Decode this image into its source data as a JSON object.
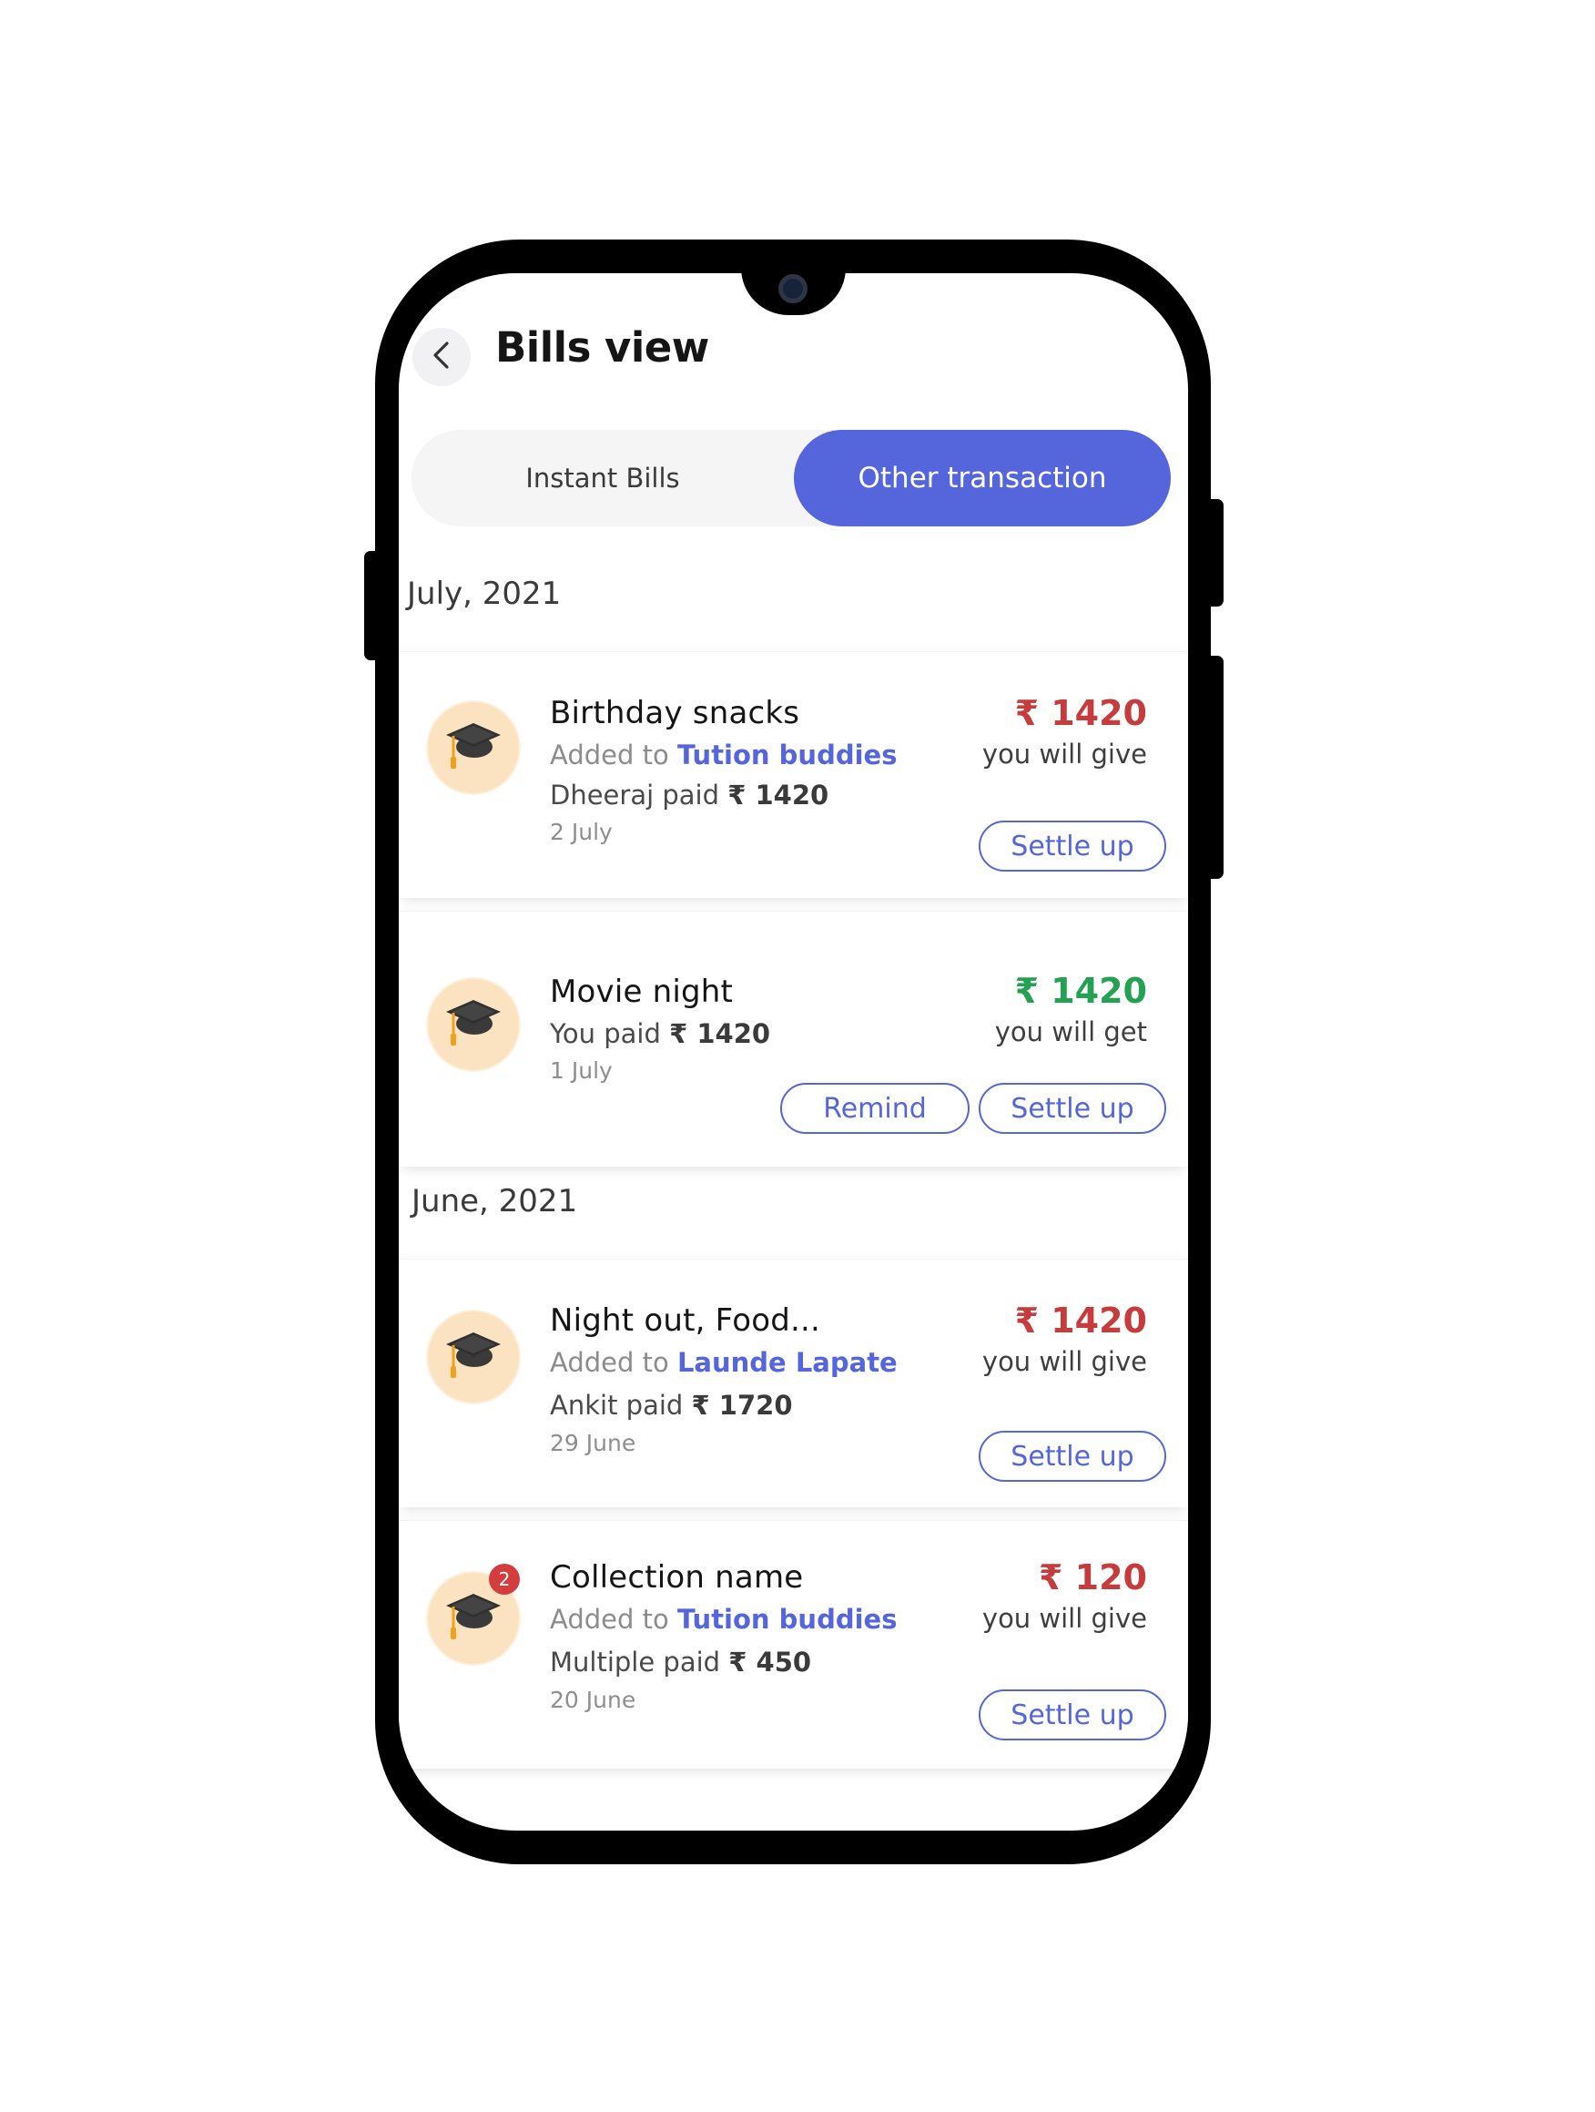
{
  "header": {
    "title": "Bills view",
    "back_icon": "chevron-left-icon"
  },
  "tabs": [
    {
      "label": "Instant Bills",
      "active": false
    },
    {
      "label": "Other transaction",
      "active": true
    }
  ],
  "colors": {
    "accent": "#5565db",
    "give": "#c63b3b",
    "get": "#24a152",
    "avatar_bg": "#fbe3c2",
    "badge": "#d43d3d"
  },
  "sections": [
    {
      "month": "July, 2021",
      "bills": [
        {
          "title": "Birthday snacks",
          "added_prefix": "Added to",
          "group": "Tution buddies",
          "paid_prefix": "Dheeraj paid",
          "paid_amount": "₹ 1420",
          "date": "2 July",
          "amount": "₹ 1420",
          "status": "you will give",
          "direction": "give",
          "icon": "graduation-cap-icon",
          "buttons": [
            "Settle up"
          ]
        },
        {
          "title": "Movie night",
          "paid_prefix": "You paid",
          "paid_amount": "₹ 1420",
          "date": "1 July",
          "amount": "₹ 1420",
          "status": "you will get",
          "direction": "get",
          "icon": "graduation-cap-icon",
          "buttons": [
            "Remind",
            "Settle up"
          ]
        }
      ]
    },
    {
      "month": "June, 2021",
      "bills": [
        {
          "title": "Night out, Food...",
          "added_prefix": "Added to",
          "group": "Launde Lapate",
          "paid_prefix": "Ankit paid",
          "paid_amount": "₹ 1720",
          "date": "29 June",
          "amount": "₹ 1420",
          "status": "you will give",
          "direction": "give",
          "icon": "graduation-cap-icon",
          "buttons": [
            "Settle up"
          ]
        },
        {
          "title": "Collection name",
          "added_prefix": "Added to",
          "group": "Tution buddies",
          "paid_prefix": "Multiple paid",
          "paid_amount": "₹ 450",
          "date": "20 June",
          "amount": "₹ 120",
          "status": "you will give",
          "direction": "give",
          "icon": "graduation-cap-icon",
          "badge_count": "2",
          "buttons": [
            "Settle up"
          ]
        }
      ]
    }
  ]
}
